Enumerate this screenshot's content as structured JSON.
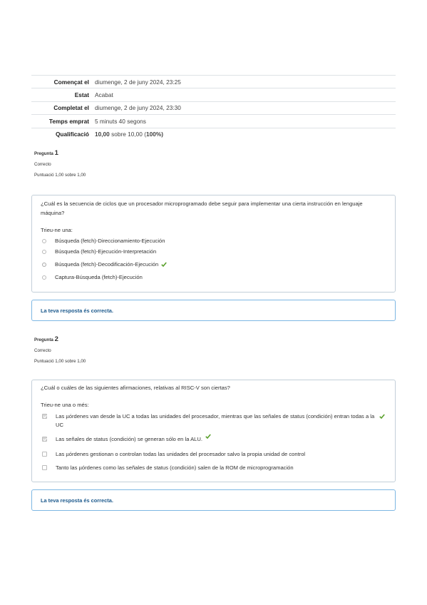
{
  "summary": {
    "rows": [
      {
        "key": "Començat el",
        "value": "diumenge, 2 de juny 2024, 23:25"
      },
      {
        "key": "Estat",
        "value": "Acabat"
      },
      {
        "key": "Completat el",
        "value": "diumenge, 2 de juny 2024, 23:30"
      },
      {
        "key": "Temps emprat",
        "value": "5 minuts 40 segons"
      },
      {
        "key": "Qualificació",
        "value_bold": "10,00",
        "value_mid": " sobre 10,00 (",
        "value_pct": "100",
        "value_end": "%)"
      }
    ]
  },
  "questions": [
    {
      "label": "Pregunta",
      "number": "1",
      "status": "Correcto",
      "score": "Puntuació 1,00 sobre 1,00",
      "text": "¿Cuál es la secuencia de ciclos que un procesador microprogramado debe seguir para implementar una cierta instrucción en lenguaje máquina?",
      "prompt": "Trieu-ne una:",
      "options": [
        {
          "label": "Búsqueda (fetch)-Direccionamiento-Ejecución",
          "selected": false,
          "correct": false
        },
        {
          "label": "Búsqueda (fetch)-Ejecución-Interpretación",
          "selected": false,
          "correct": false
        },
        {
          "label": "Búsqueda (fetch)-Decodificación-Ejecución",
          "selected": true,
          "correct": true
        },
        {
          "label": "Captura-Búsqueda (fetch)-Ejecución",
          "selected": false,
          "correct": false
        }
      ],
      "feedback": "La teva resposta és correcta."
    },
    {
      "label": "Pregunta",
      "number": "2",
      "status": "Correcto",
      "score": "Puntuació 1,00 sobre 1,00",
      "text": "¿Cuál o cuáles de las siguientes afirmaciones, relativas al RISC-V son ciertas?",
      "prompt": "Trieu-ne una o més:",
      "options": [
        {
          "label": "Las µórdenes van desde la UC a todas las unidades del procesador, mientras que las señales de status (condición) entran todas a la UC",
          "selected": true,
          "correct": true
        },
        {
          "label": "Las señales de status (condición) se generan sólo en la ALU.",
          "selected": true,
          "correct": true
        },
        {
          "label": "Las µórdenes gestionan o controlan todas las unidades del procesador salvo la propia unidad de control",
          "selected": false,
          "correct": false
        },
        {
          "label": "Tanto las µórdenes como las señales de status (condición) salen de la ROM de microprogramación",
          "selected": false,
          "correct": false
        }
      ],
      "feedback": "La teva resposta és correcta."
    }
  ],
  "colors": {
    "correct": "#5aa02c",
    "feedback_text": "#1d5a8d",
    "feedback_border": "#7db7e3"
  },
  "icons": {
    "correct": "check-icon"
  }
}
